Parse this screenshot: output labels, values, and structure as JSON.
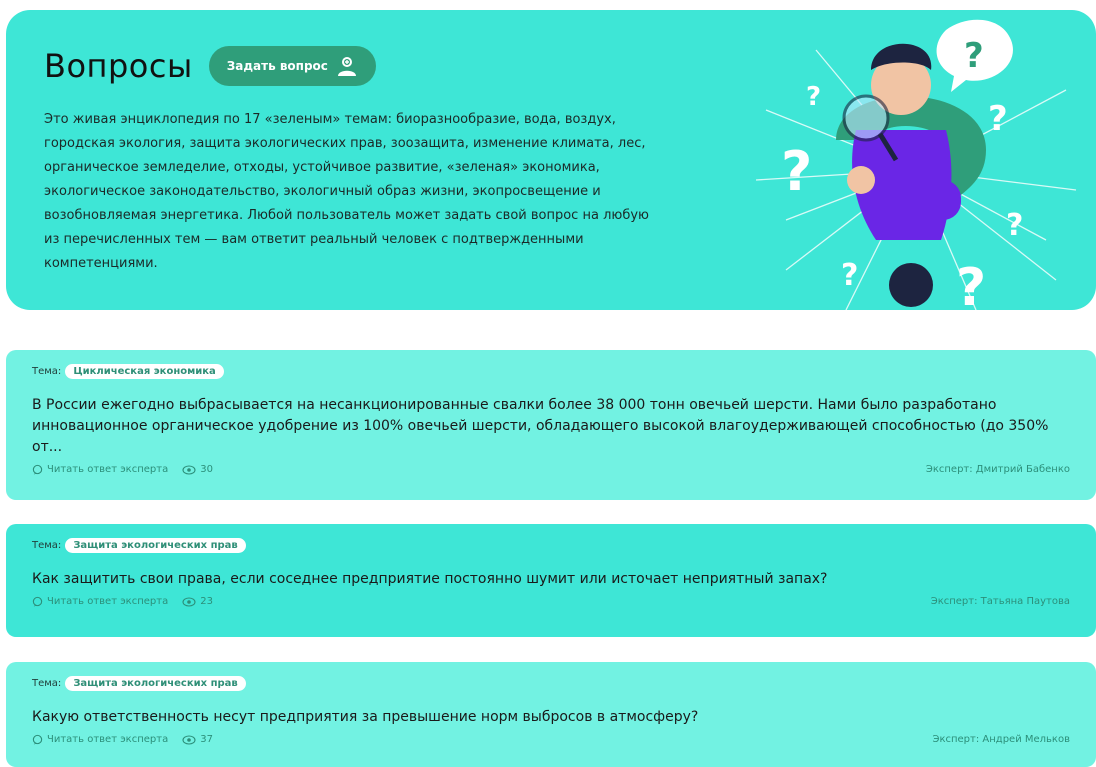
{
  "hero": {
    "title": "Вопросы",
    "ask_button_label": "Задать вопрос",
    "description": "Это живая энциклопедия по 17 «зеленым» темам: биоразнообразие, вода, воздух, городская экология, защита экологических прав, зоозащита, изменение климата, лес, органическое земледелие, отходы, устойчивое развитие, «зеленая» экономика, экологическое законодательство, экологичный образ жизни, экопросвещение и возобновляемая энергетика. Любой пользователь может задать свой вопрос на любую из перечисленных тем — вам ответит реальный человек с подтвержденными компетенциями."
  },
  "questions": [
    {
      "topic_label": "Тема:",
      "topic": "Циклическая экономика",
      "text": "В России ежегодно выбрасывается на несанкционированные свалки более 38 000 тонн овечьей шерсти. Нами было разработано инновационное органическое удобрение из 100% овечьей шерсти, обладающего высокой влагоудерживающей способностью (до 350% от...",
      "read_label": "Читать ответ эксперта",
      "views": "30",
      "expert": "Эксперт:  Дмитрий Бабенко"
    },
    {
      "topic_label": "Тема:",
      "topic": "Защита экологических прав",
      "text": "Как защитить свои права, если соседнее предприятие постоянно шумит или источает неприятный запах?",
      "read_label": "Читать ответ эксперта",
      "views": "23",
      "expert": "Эксперт:  Татьяна Паутова"
    },
    {
      "topic_label": "Тема:",
      "topic": "Защита экологических прав",
      "text": "Какую ответственность несут предприятия за превышение норм выбросов в атмосферу?",
      "read_label": "Читать ответ эксперта",
      "views": "37",
      "expert": "Эксперт:  Андрей Мельков"
    }
  ],
  "colors": {
    "hero_bg": "#3ee6d6",
    "card_light": "#72f2e2",
    "button": "#2f9e7a",
    "accent_text": "#2c8f7a"
  },
  "icons": {
    "ask_button": "add-user-icon",
    "read": "comment-icon",
    "views": "eye-icon"
  }
}
